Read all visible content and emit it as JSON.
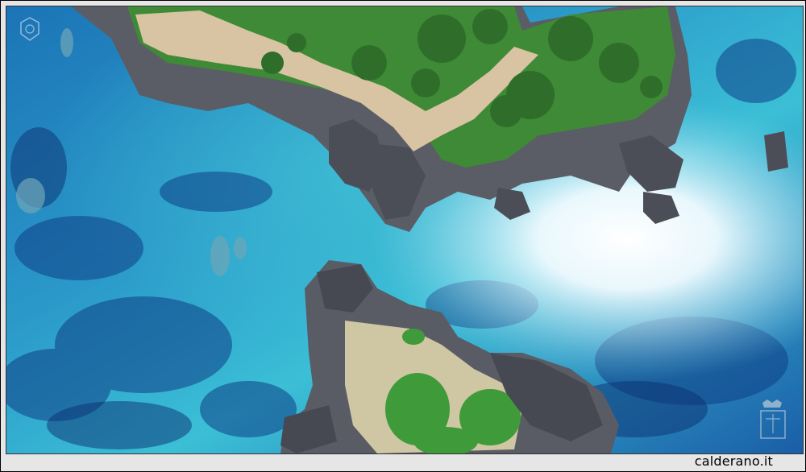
{
  "photo": {
    "caption": "calderano.it"
  },
  "colors": {
    "deep_sea": "#1f6fb8",
    "shallow_sea": "#2fb6d4",
    "rock": "#5d5f68",
    "vegetation": "#3f8a36",
    "sand": "#d8c3a3",
    "glare": "#ffffff"
  }
}
